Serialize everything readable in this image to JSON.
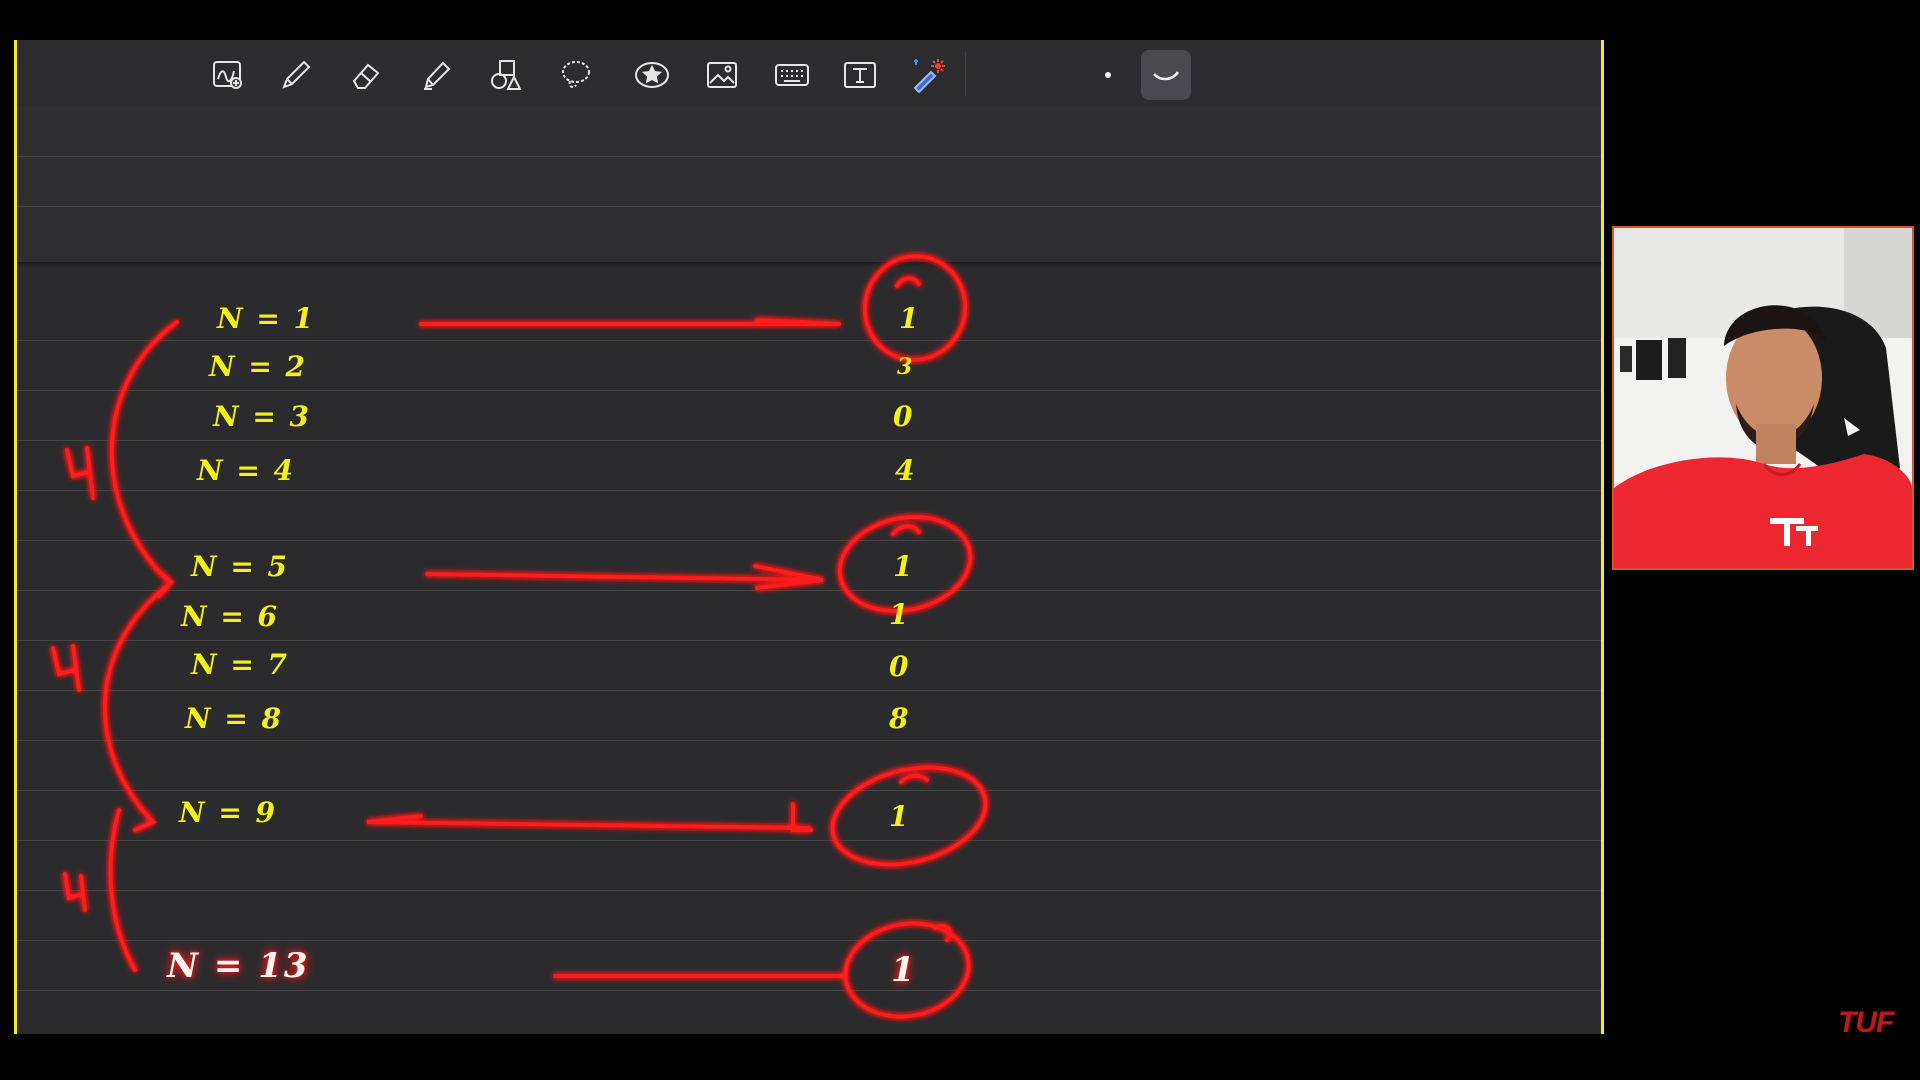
{
  "toolbar": {
    "tools": [
      {
        "name": "handwriting-insert-icon"
      },
      {
        "name": "pen-icon"
      },
      {
        "name": "eraser-icon"
      },
      {
        "name": "highlighter-icon"
      },
      {
        "name": "shapes-icon"
      },
      {
        "name": "lasso-icon"
      },
      {
        "name": "sticker-icon"
      },
      {
        "name": "image-icon"
      },
      {
        "name": "keyboard-icon"
      },
      {
        "name": "text-icon"
      },
      {
        "name": "laser-pointer-icon"
      }
    ],
    "size_dot": "small",
    "stroke_style": "curve",
    "active_tool": "stroke-style"
  },
  "colors": {
    "ink_yellow": "#f4f01c",
    "ink_red": "#ff1a1a",
    "glow_red": "#ff0000",
    "border_yellow": "#f2ea2a"
  },
  "notes": {
    "left_labels": [
      "N = 1",
      "N = 2",
      "N = 3",
      "N = 4",
      "N = 5",
      "N = 6",
      "N = 7",
      "N = 8",
      "N = 9",
      "N = 13"
    ],
    "right_values": [
      "1",
      "3",
      "0",
      "4",
      "1",
      "1",
      "0",
      "8",
      "1",
      "1"
    ],
    "bracket_labels": [
      "4",
      "4",
      "4"
    ]
  },
  "watermark": "TUF"
}
